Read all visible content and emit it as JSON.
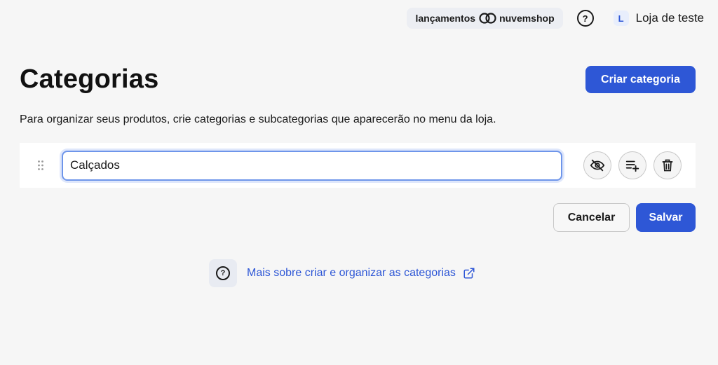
{
  "topbar": {
    "news_label": "lançamentos",
    "brand_name": "nuvemshop",
    "help_icon": "question-circle-icon",
    "store_initial": "L",
    "store_name": "Loja de teste"
  },
  "header": {
    "title": "Categorias",
    "create_button_label": "Criar categoria",
    "description": "Para organizar seus produtos, crie categorias e subcategorias que aparecerão no menu da loja."
  },
  "category_row": {
    "name_value": "Calçados",
    "actions": [
      {
        "icon": "eye-off-icon"
      },
      {
        "icon": "add-subcategory-icon"
      },
      {
        "icon": "trash-icon"
      }
    ]
  },
  "footer_actions": {
    "cancel_label": "Cancelar",
    "save_label": "Salvar"
  },
  "help": {
    "link_text": "Mais sobre criar e organizar as categorias",
    "icon": "external-link-icon"
  },
  "colors": {
    "accent": "#2e57d6",
    "background": "#f6f6f6"
  }
}
